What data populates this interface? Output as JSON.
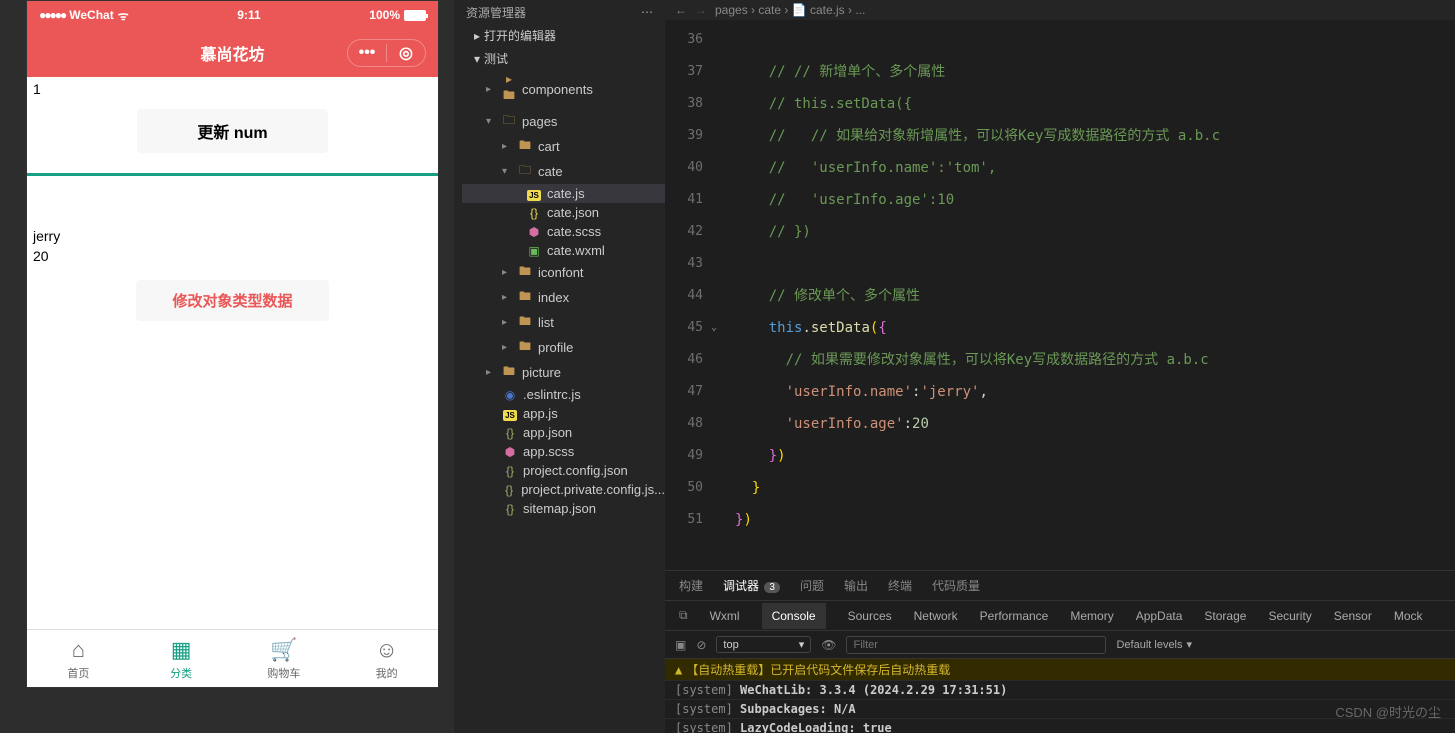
{
  "simulator": {
    "statusBar": {
      "carrier": "WeChat",
      "time": "9:11",
      "battery": "100%"
    },
    "navTitle": "慕尚花坊",
    "section1": {
      "num": "1",
      "btn": "更新 num"
    },
    "section2": {
      "name": "jerry",
      "age": "20",
      "btn": "修改对象类型数据"
    },
    "tabs": [
      {
        "icon": "⌂",
        "label": "首页"
      },
      {
        "icon": "▦",
        "label": "分类"
      },
      {
        "icon": "🛒",
        "label": "购物车"
      },
      {
        "icon": "☺",
        "label": "我的"
      }
    ]
  },
  "explorer": {
    "title": "资源管理器",
    "sections": {
      "openEditors": "打开的编辑器",
      "project": "测试"
    },
    "tree": {
      "components": "components",
      "pages": "pages",
      "cart": "cart",
      "cate": "cate",
      "catejs": "cate.js",
      "catejson": "cate.json",
      "catescss": "cate.scss",
      "catewxml": "cate.wxml",
      "iconfont": "iconfont",
      "index": "index",
      "list": "list",
      "profile": "profile",
      "picture": "picture",
      "eslintrc": ".eslintrc.js",
      "appjs": "app.js",
      "appjson": "app.json",
      "appscss": "app.scss",
      "projectconfig": "project.config.json",
      "projectprivate": "project.private.config.js...",
      "sitemap": "sitemap.json"
    }
  },
  "editor": {
    "breadcrumb": "pages › cate › 📄 cate.js › ...",
    "lines": [
      {
        "num": 36,
        "html": ""
      },
      {
        "num": 37,
        "html": "    <span class='c-comment'>// // 新增单个、多个属性</span>"
      },
      {
        "num": 38,
        "html": "    <span class='c-comment'>// this.setData({</span>"
      },
      {
        "num": 39,
        "html": "    <span class='c-comment'>//   // 如果给对象新增属性，可以将Key写成数据路径的方式 a.b.c</span>"
      },
      {
        "num": 40,
        "html": "    <span class='c-comment'>//   'userInfo.name':'tom',</span>"
      },
      {
        "num": 41,
        "html": "    <span class='c-comment'>//   'userInfo.age':10</span>"
      },
      {
        "num": 42,
        "html": "    <span class='c-comment'>// })</span>"
      },
      {
        "num": 43,
        "html": ""
      },
      {
        "num": 44,
        "html": "    <span class='c-comment'>// 修改单个、多个属性</span>"
      },
      {
        "num": 45,
        "html": "    <span class='c-this'>this</span><span class='c-punct'>.</span><span class='c-method'>setData</span><span class='c-brace'>(</span><span class='c-brace2'>{</span>",
        "fold": true
      },
      {
        "num": 46,
        "html": "      <span class='c-comment'>// 如果需要修改对象属性，可以将Key写成数据路径的方式 a.b.c</span>"
      },
      {
        "num": 47,
        "html": "      <span class='c-string'>'userInfo.name'</span><span class='c-punct'>:</span><span class='c-string'>'jerry'</span><span class='c-punct'>,</span>"
      },
      {
        "num": 48,
        "html": "      <span class='c-string'>'userInfo.age'</span><span class='c-punct'>:</span><span class='c-number'>20</span>"
      },
      {
        "num": 49,
        "html": "    <span class='c-brace2'>}</span><span class='c-brace'>)</span>"
      },
      {
        "num": 50,
        "html": "  <span class='c-brace'>}</span>"
      },
      {
        "num": 51,
        "html": "<span class='c-brace2'>}</span><span class='c-brace'>)</span>"
      }
    ]
  },
  "panel": {
    "tabs": {
      "build": "构建",
      "debugger": "调试器",
      "debuggerBadge": "3",
      "problems": "问题",
      "output": "输出",
      "terminal": "终端",
      "quality": "代码质量"
    },
    "devtools": {
      "wxml": "Wxml",
      "console": "Console",
      "sources": "Sources",
      "network": "Network",
      "performance": "Performance",
      "memory": "Memory",
      "appdata": "AppData",
      "storage": "Storage",
      "security": "Security",
      "sensor": "Sensor",
      "mock": "Mock"
    },
    "toolbar": {
      "context": "top",
      "filterPlaceholder": "Filter",
      "levels": "Default levels"
    },
    "messages": [
      {
        "type": "warn",
        "text": "【自动热重载】已开启代码文件保存后自动热重载"
      },
      {
        "type": "log",
        "prefix": "[system]",
        "text": " WeChatLib: 3.3.4 (2024.2.29 17:31:51)"
      },
      {
        "type": "log",
        "prefix": "[system]",
        "text": " Subpackages: N/A"
      },
      {
        "type": "log",
        "prefix": "[system]",
        "text": " LazyCodeLoading: true"
      }
    ]
  },
  "watermark": "CSDN @时光の尘"
}
